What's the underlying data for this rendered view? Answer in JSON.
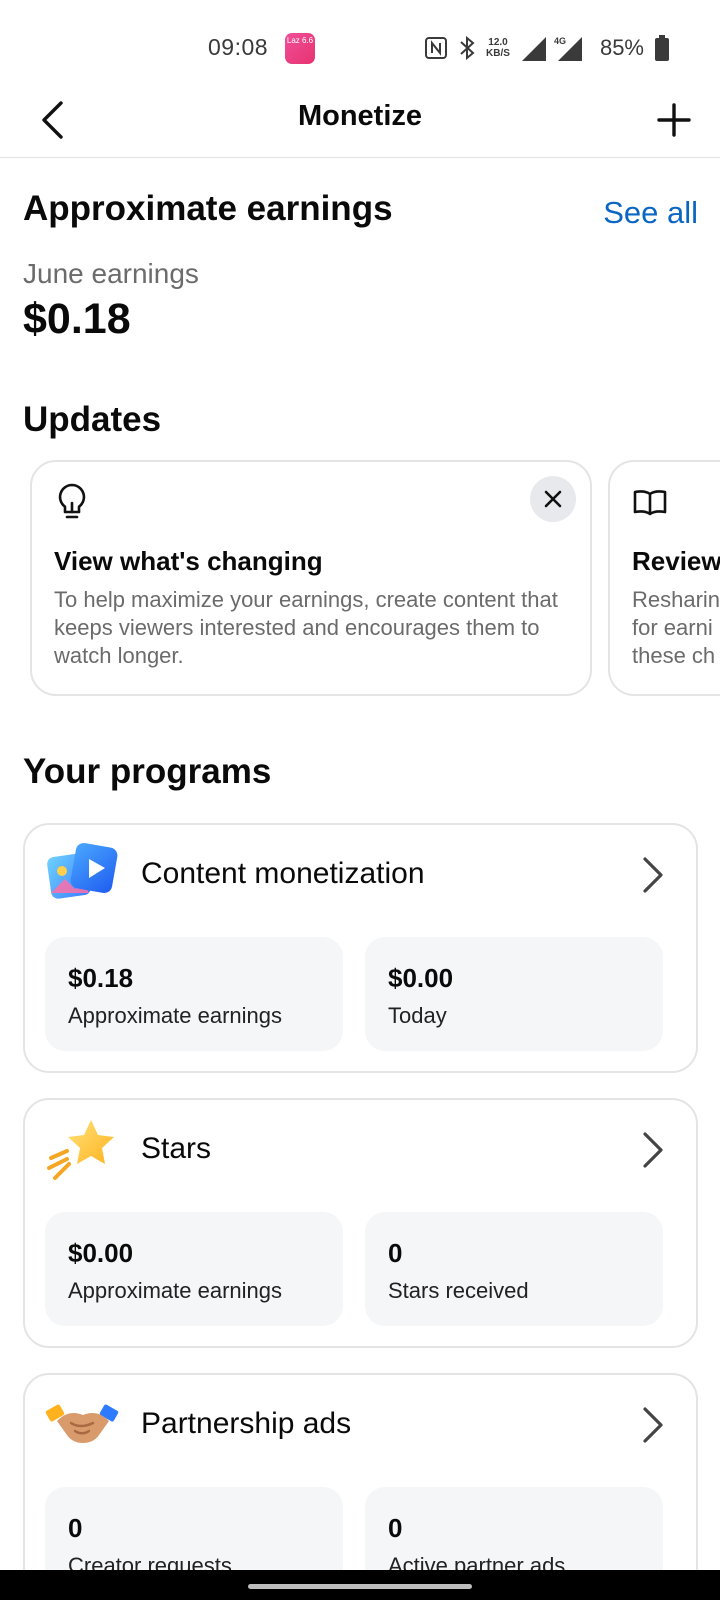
{
  "status_bar": {
    "time": "09:08",
    "laz_app_badge": "Laz 6.6",
    "speed_value": "12.0",
    "speed_unit": "KB/S",
    "network": "4G",
    "battery_percent": "85%"
  },
  "header": {
    "title": "Monetize",
    "back_icon": "chevron-left-icon",
    "add_icon": "plus-icon"
  },
  "earnings": {
    "title": "Approximate earnings",
    "see_all_label": "See all",
    "period_label": "June earnings",
    "amount": "$0.18"
  },
  "updates": {
    "title": "Updates",
    "cards": [
      {
        "icon": "lightbulb-icon",
        "title": "View what's changing",
        "body": "To help maximize your earnings, create content that keeps viewers interested and encourages them to watch longer."
      },
      {
        "icon": "book-icon",
        "title": "Review",
        "body": "Resharin for earni these ch"
      }
    ]
  },
  "programs": {
    "title": "Your programs",
    "items": [
      {
        "name": "Content monetization",
        "icon": "content-monetization-icon",
        "stats": [
          {
            "value": "$0.18",
            "label": "Approximate earnings"
          },
          {
            "value": "$0.00",
            "label": "Today"
          }
        ]
      },
      {
        "name": "Stars",
        "icon": "star-icon",
        "stats": [
          {
            "value": "$0.00",
            "label": "Approximate earnings"
          },
          {
            "value": "0",
            "label": "Stars received"
          }
        ]
      },
      {
        "name": "Partnership ads",
        "icon": "handshake-icon",
        "stats": [
          {
            "value": "0",
            "label": "Creator requests"
          },
          {
            "value": "0",
            "label": "Active partner ads"
          }
        ]
      }
    ]
  },
  "colors": {
    "link": "#0a66c2",
    "card_border": "#e4e4e4",
    "stat_bg": "#f5f6f7"
  }
}
